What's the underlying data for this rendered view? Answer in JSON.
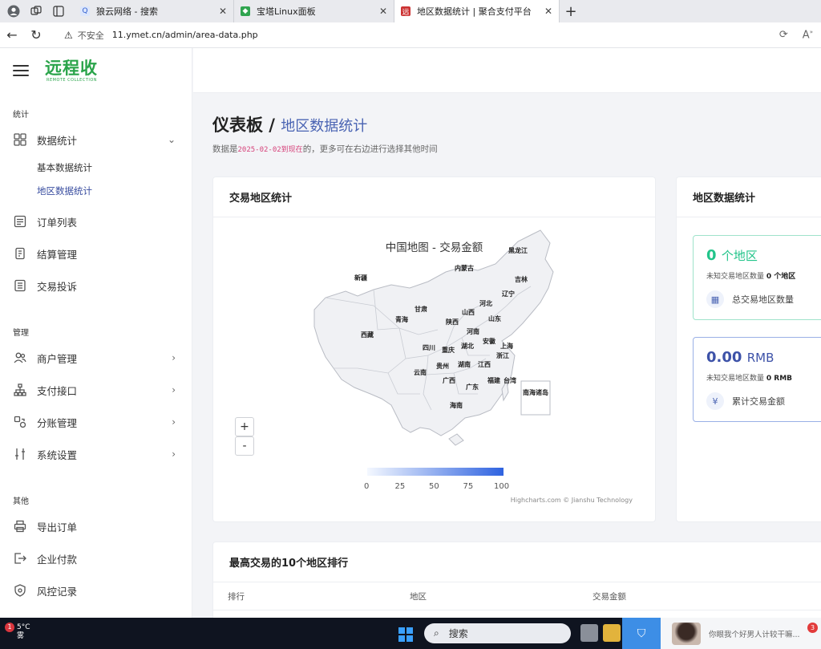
{
  "browser": {
    "tabs": [
      {
        "label": "狼云网络 - 搜索"
      },
      {
        "label": "宝塔Linux面板"
      },
      {
        "label": "地区数据统计 | 聚合支付平台"
      }
    ],
    "security_label": "不安全",
    "url": "11.ymet.cn/admin/area-data.php"
  },
  "brand": {
    "logo_text": "远程收",
    "logo_subtext": "REMOTE COLLECTION"
  },
  "sidebar": {
    "section_stats": "统计",
    "data_stats": "数据统计",
    "sub_basic": "基本数据统计",
    "sub_area": "地区数据统计",
    "orders": "订单列表",
    "settlement": "结算管理",
    "complaints": "交易投诉",
    "section_manage": "管理",
    "merchants": "商户管理",
    "payment": "支付接口",
    "split": "分账管理",
    "system": "系统设置",
    "section_other": "其他",
    "export": "导出订单",
    "enterprise_pay": "企业付款",
    "risk": "风控记录"
  },
  "page": {
    "title": "仪表板",
    "separator": " / ",
    "crumb": "地区数据统计",
    "sub_prefix": "数据是",
    "sub_date": "2025-02-02到现在",
    "sub_suffix": "的，更多可在右边进行选择其他时间"
  },
  "map_card": {
    "header": "交易地区统计",
    "chart_title": "中国地图 - 交易金额",
    "zoom_in": "+",
    "zoom_out": "-",
    "credits": "Highcharts.com © Jianshu Technology"
  },
  "chart_data": {
    "type": "map",
    "title": "中国地图 - 交易金额",
    "color_axis": {
      "min": 0,
      "max": 100,
      "ticks": [
        "0",
        "25",
        "50",
        "75",
        "100"
      ],
      "from_color": "#f4f8ff",
      "to_color": "#2f63e0"
    },
    "regions": [
      "黑龙江",
      "内蒙古",
      "吉林",
      "新疆",
      "辽宁",
      "河北",
      "甘肃",
      "山西",
      "山东",
      "青海",
      "陕西",
      "河南",
      "西藏",
      "安徽",
      "上海",
      "四川",
      "重庆",
      "湖北",
      "浙江",
      "贵州",
      "湖南",
      "江西",
      "云南",
      "广西",
      "福建",
      "广东",
      "台湾",
      "南海诸岛",
      "海南"
    ],
    "values": []
  },
  "region_card": {
    "header": "地区数据统计",
    "count_value": "0",
    "count_unit": "个地区",
    "count_note_prefix": "未知交易地区数量",
    "count_note_value": "0 个地区",
    "count_label": "总交易地区数量",
    "amount_value": "0.00",
    "amount_unit": "RMB",
    "amount_note_prefix": "未知交易地区数量",
    "amount_note_value": "0 RMB",
    "amount_label": "累计交易金额",
    "green": "#22c48a",
    "blue": "#3d52a8"
  },
  "top10_card": {
    "header": "最高交易的10个地区排行",
    "columns": [
      "排行",
      "地区",
      "交易金额"
    ]
  },
  "taskbar": {
    "temperature": "5°C",
    "weather": "雾",
    "weather_badge": "1",
    "search_label": "搜索",
    "chat_text": "你眼我个好男人计较干嘛...",
    "chat_count": "3"
  }
}
